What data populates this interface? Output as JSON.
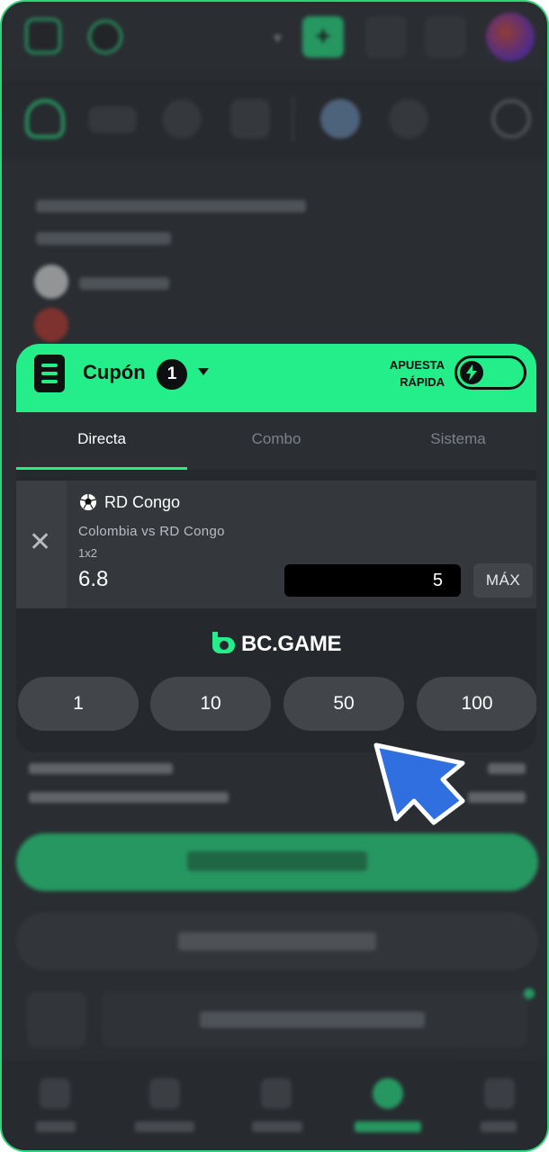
{
  "coupon": {
    "title": "Cupón",
    "count": "1",
    "quick_bet_label_line1": "APUESTA",
    "quick_bet_label_line2": "RÁPIDA",
    "tabs": [
      {
        "label": "Directa",
        "active": true
      },
      {
        "label": "Combo",
        "active": false
      },
      {
        "label": "Sistema",
        "active": false
      }
    ],
    "bet": {
      "team": "RD Congo",
      "match": "Colombia vs RD Congo",
      "market": "1x2",
      "odds": "6.8",
      "stake": "5",
      "max_label": "MÁX"
    },
    "brand": "BC.GAME",
    "amounts": [
      "1",
      "10",
      "50",
      "100"
    ]
  },
  "colors": {
    "accent": "#24ee89",
    "panel": "#25282c",
    "pointer": "#2f6fe0"
  },
  "icons": {
    "menu": "coupon-menu-icon",
    "toggle": "lightning-icon",
    "close": "close-icon",
    "sport": "soccer-ball-icon",
    "pointer": "pointer-arrow-icon"
  }
}
